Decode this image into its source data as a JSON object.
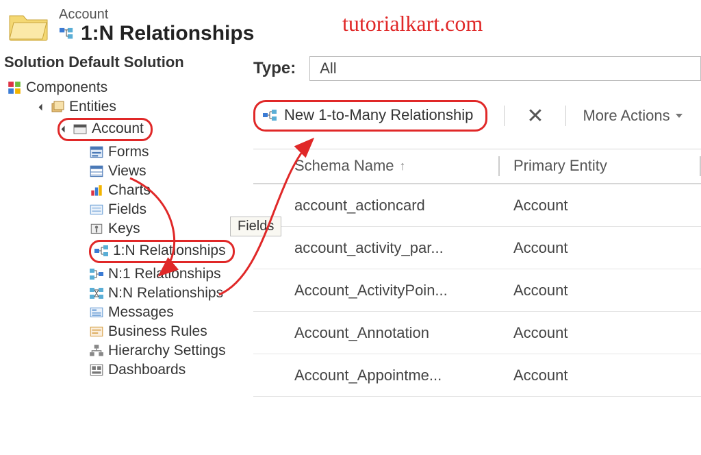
{
  "header": {
    "entity": "Account",
    "title": "1:N Relationships"
  },
  "watermark": "tutorialkart.com",
  "solution": {
    "label": "Solution Default Solution"
  },
  "tree": {
    "components": "Components",
    "entities": "Entities",
    "account": "Account",
    "children": {
      "forms": "Forms",
      "views": "Views",
      "charts": "Charts",
      "fields": "Fields",
      "keys": "Keys",
      "rel_1n": "1:N Relationships",
      "rel_n1": "N:1 Relationships",
      "rel_nn": "N:N Relationships",
      "messages": "Messages",
      "business_rules": "Business Rules",
      "hierarchy": "Hierarchy Settings",
      "dashboards": "Dashboards"
    },
    "tooltip_fields": "Fields"
  },
  "typeFilter": {
    "label": "Type:",
    "value": "All"
  },
  "toolbar": {
    "new_relationship": "New 1-to-Many Relationship",
    "more_actions": "More Actions"
  },
  "grid": {
    "columns": {
      "schema_name": "Schema Name",
      "primary_entity": "Primary Entity"
    },
    "rows": [
      {
        "schema": "account_actioncard",
        "entity": "Account"
      },
      {
        "schema": "account_activity_par...",
        "entity": "Account"
      },
      {
        "schema": "Account_ActivityPoin...",
        "entity": "Account"
      },
      {
        "schema": "Account_Annotation",
        "entity": "Account"
      },
      {
        "schema": "Account_Appointme...",
        "entity": "Account"
      }
    ]
  }
}
